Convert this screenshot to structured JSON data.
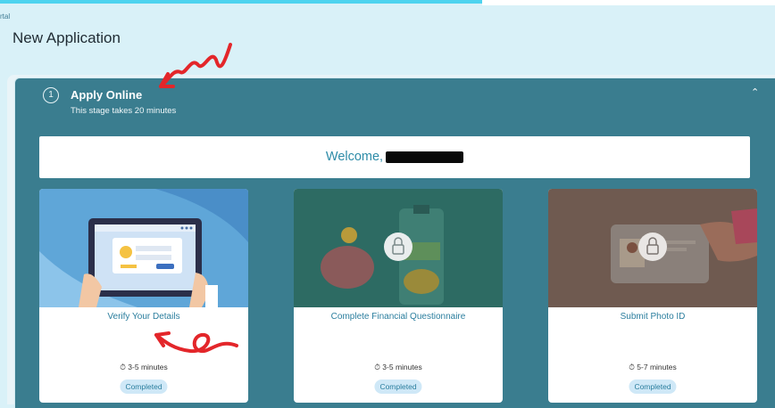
{
  "breadcrumb": "rtal",
  "page_title": "New Application",
  "stage": {
    "number": "1",
    "title": "Apply Online",
    "subtitle": "This stage takes 20 minutes"
  },
  "welcome": "Welcome,",
  "tasks": [
    {
      "label": "Verify Your Details",
      "time": "3-5 minutes",
      "status": "Completed",
      "icon": "id-card-tablet-illustration"
    },
    {
      "label": "Complete Financial Questionnaire",
      "time": "3-5 minutes",
      "status": "Completed",
      "icon": "piggy-bank-lock-illustration"
    },
    {
      "label": "Submit Photo ID",
      "time": "5-7 minutes",
      "status": "Completed",
      "icon": "photo-id-lock-illustration"
    }
  ],
  "colors": {
    "accent": "#4dd3ef",
    "stage_bg": "#3a7d8f",
    "link": "#2b7e9e",
    "annotation": "#e3262a"
  }
}
